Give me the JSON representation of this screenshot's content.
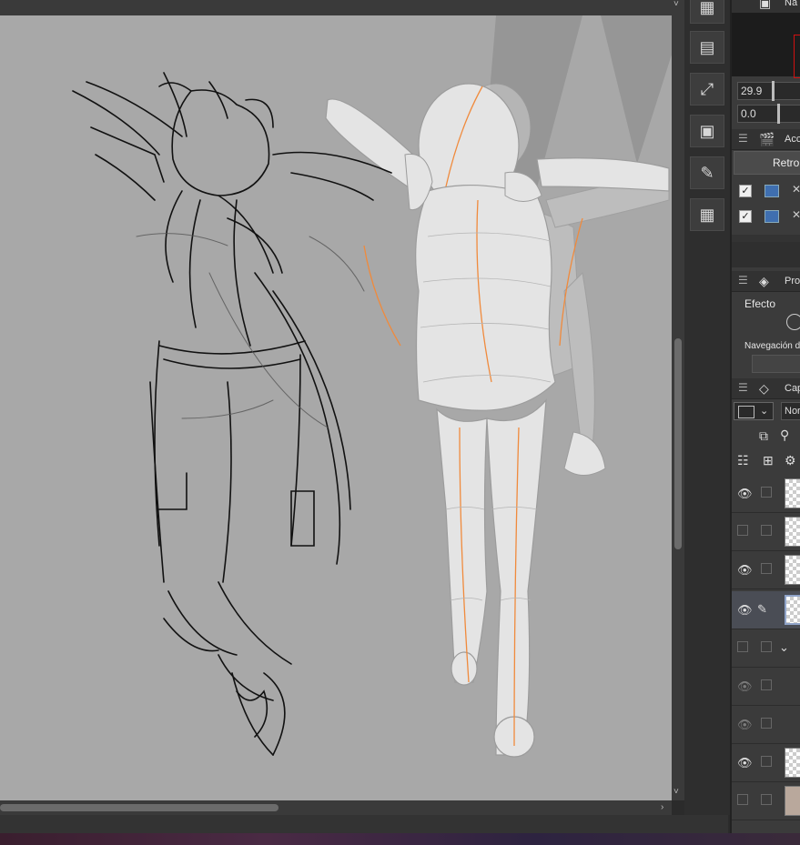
{
  "canvas": {
    "background": "#a8a8a8"
  },
  "tools": [
    {
      "icon": "grid-icon",
      "glyph": "▦"
    },
    {
      "icon": "layer-stack-icon",
      "glyph": "▤"
    },
    {
      "icon": "transform-icon",
      "glyph": "⤢"
    },
    {
      "icon": "image-icon",
      "glyph": "▣"
    },
    {
      "icon": "edit-icon",
      "glyph": "✎"
    },
    {
      "icon": "grid-icon",
      "glyph": "▦"
    }
  ],
  "navigator": {
    "title": "Na",
    "zoom_value": "29.9",
    "rotate_value": "0.0"
  },
  "auto_actions": {
    "title": "Acc",
    "button_label": "Retro"
  },
  "properties": {
    "title": "Pro",
    "effect_label": "Efecto",
    "navigation_label": "Navegación d"
  },
  "layers": {
    "title": "Cap",
    "blend_mode": "Nor"
  },
  "scroll": {
    "down_arrow": "˅",
    "right_arrow": "›"
  }
}
